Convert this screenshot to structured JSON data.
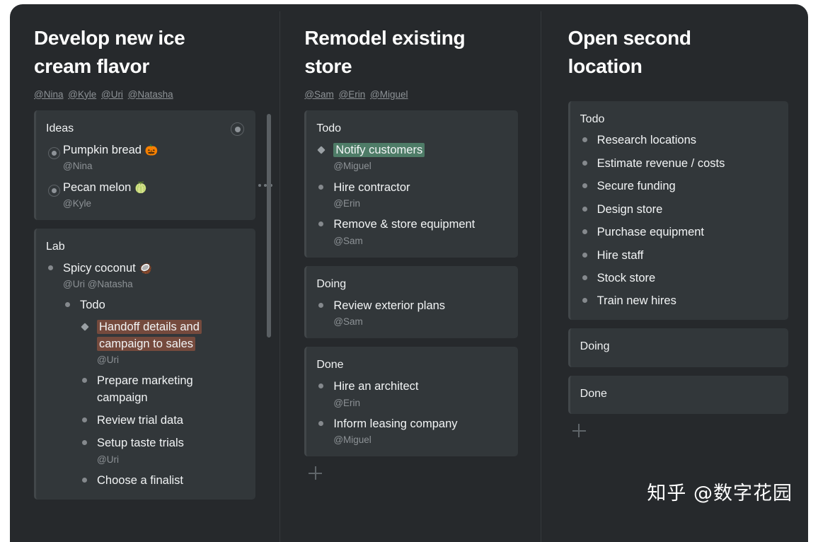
{
  "theme": {
    "page_bg": "#26292c",
    "card_bg": "#32373a",
    "text_primary": "#f2f4f5",
    "text_muted": "#8d9296",
    "highlight_green": "#4e7c67",
    "highlight_rust": "#754a3d"
  },
  "watermark": {
    "text": "知乎 @数字花园"
  },
  "columns": [
    {
      "title": "Develop new ice cream flavor",
      "mentions": [
        "@Nina",
        "@Kyle",
        "@Uri",
        "@Natasha"
      ],
      "more_icon": "ellipsis-icon",
      "cards": [
        {
          "title": "Ideas",
          "toggle_icon": "ring-dot-icon",
          "items": [
            {
              "bullet": "ring",
              "text": "Pumpkin bread",
              "emoji": "🎃",
              "assignees": "@Nina"
            },
            {
              "bullet": "ring",
              "text": "Pecan melon",
              "emoji": "🍈",
              "assignees": "@Kyle"
            }
          ]
        },
        {
          "title": "Lab",
          "items": [
            {
              "bullet": "dot",
              "text": "Spicy coconut",
              "emoji": "🥥",
              "assignees": "@Uri @Natasha",
              "children": [
                {
                  "bullet": "dot",
                  "text": "Todo",
                  "children": [
                    {
                      "bullet": "diamond",
                      "text": "Handoff details and campaign to sales",
                      "highlight": "rust",
                      "assignees": "@Uri"
                    },
                    {
                      "bullet": "dot",
                      "text": "Prepare marketing campaign"
                    },
                    {
                      "bullet": "dot",
                      "text": "Review trial data"
                    },
                    {
                      "bullet": "dot",
                      "text": "Setup taste trials",
                      "assignees": "@Uri"
                    },
                    {
                      "bullet": "dot",
                      "text": "Choose a finalist"
                    }
                  ]
                }
              ]
            }
          ]
        }
      ]
    },
    {
      "title": "Remodel existing store",
      "mentions": [
        "@Sam",
        "@Erin",
        "@Miguel"
      ],
      "add_icon": "plus-icon",
      "cards": [
        {
          "title": "Todo",
          "items": [
            {
              "bullet": "diamond",
              "text": "Notify customers",
              "highlight": "green",
              "assignees": "@Miguel"
            },
            {
              "bullet": "dot",
              "text": "Hire contractor",
              "assignees": "@Erin"
            },
            {
              "bullet": "dot",
              "text": "Remove & store equipment",
              "assignees": "@Sam"
            }
          ]
        },
        {
          "title": "Doing",
          "items": [
            {
              "bullet": "dot",
              "text": "Review exterior plans",
              "assignees": "@Sam"
            }
          ]
        },
        {
          "title": "Done",
          "items": [
            {
              "bullet": "dot",
              "text": "Hire an architect",
              "assignees": "@Erin"
            },
            {
              "bullet": "dot",
              "text": "Inform leasing company",
              "assignees": "@Miguel"
            }
          ]
        }
      ]
    },
    {
      "title": "Open second location",
      "mentions": [],
      "add_icon": "plus-icon",
      "cards": [
        {
          "title": "Todo",
          "items": [
            {
              "bullet": "dot",
              "text": "Research locations"
            },
            {
              "bullet": "dot",
              "text": "Estimate revenue / costs"
            },
            {
              "bullet": "dot",
              "text": "Secure funding"
            },
            {
              "bullet": "dot",
              "text": "Design store"
            },
            {
              "bullet": "dot",
              "text": "Purchase equipment"
            },
            {
              "bullet": "dot",
              "text": "Hire staff"
            },
            {
              "bullet": "dot",
              "text": "Stock store"
            },
            {
              "bullet": "dot",
              "text": "Train new hires"
            }
          ]
        },
        {
          "title": "Doing",
          "items": []
        },
        {
          "title": "Done",
          "items": []
        }
      ]
    }
  ]
}
